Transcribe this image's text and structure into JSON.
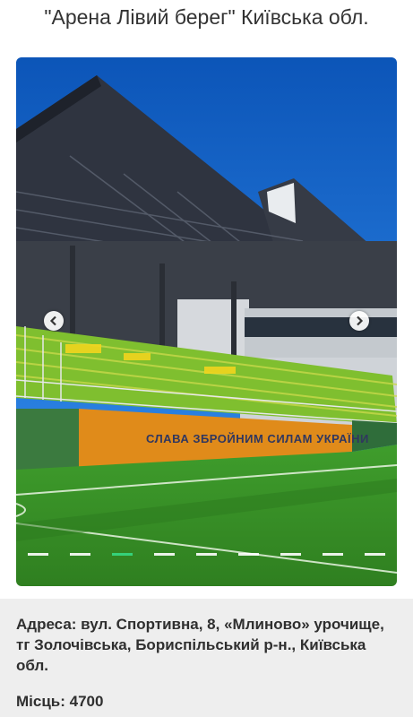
{
  "title": "\"Арена Лівий берег\" Київська обл.",
  "carousel": {
    "banner_text": "СЛАВА ЗБРОЙНИМ СИЛАМ УКРАЇНИ",
    "slide_count": 9,
    "active_slide": 3,
    "prev_icon": "chevron-left-icon",
    "next_icon": "chevron-right-icon"
  },
  "info": {
    "address": "Адреса: вул. Спортивна, 8, «Млиново» урочище, тг Золочівська, Бориспільський р-н., Київська обл.",
    "capacity": "Місць: 4700"
  }
}
